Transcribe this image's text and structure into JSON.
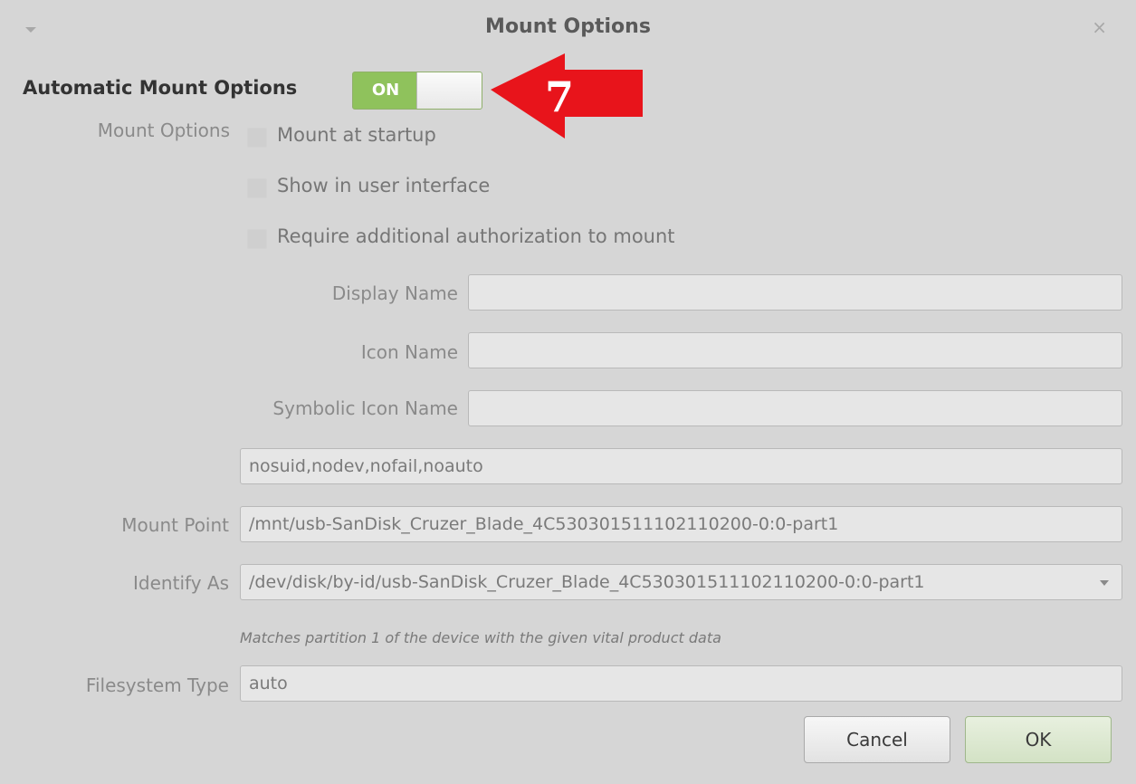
{
  "window": {
    "title": "Mount Options"
  },
  "header": {
    "auto_label": "Automatic Mount Options",
    "switch_state": "ON",
    "annotation_number": "7",
    "annotation_color": "#e8141b"
  },
  "options": {
    "label": "Mount Options",
    "checkboxes": [
      {
        "label": "Mount at startup",
        "checked": false
      },
      {
        "label": "Show in user interface",
        "checked": false
      },
      {
        "label": "Require additional authorization to mount",
        "checked": false
      }
    ]
  },
  "fields": {
    "display_name": {
      "label": "Display Name",
      "value": ""
    },
    "icon_name": {
      "label": "Icon Name",
      "value": ""
    },
    "symbolic_icon_name": {
      "label": "Symbolic Icon Name",
      "value": ""
    },
    "mount_options_text": {
      "value": "nosuid,nodev,nofail,noauto"
    },
    "mount_point": {
      "label": "Mount Point",
      "value": "/mnt/usb-SanDisk_Cruzer_Blade_4C530301511102110200-0:0-part1"
    },
    "identify_as": {
      "label": "Identify As",
      "value": "/dev/disk/by-id/usb-SanDisk_Cruzer_Blade_4C530301511102110200-0:0-part1"
    },
    "identify_hint": "Matches partition 1 of the device with the given vital product data",
    "filesystem_type": {
      "label": "Filesystem Type",
      "value": "auto"
    }
  },
  "buttons": {
    "cancel": "Cancel",
    "ok": "OK"
  },
  "colors": {
    "switch_on": "#8fc25c",
    "background": "#d6d6d6"
  }
}
